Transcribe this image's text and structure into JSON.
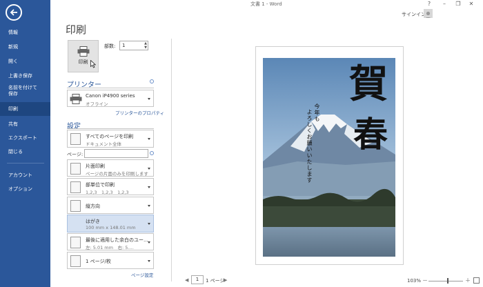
{
  "window": {
    "title": "文書 1 - Word",
    "help": "?",
    "minimize": "–",
    "restore": "❐",
    "close": "✕",
    "signin": "サインイン"
  },
  "sidebar": {
    "items": [
      {
        "label": "情報"
      },
      {
        "label": "新規"
      },
      {
        "label": "開く"
      },
      {
        "label": "上書き保存"
      },
      {
        "label": "名前を付けて"
      },
      {
        "label": "保存"
      },
      {
        "label": "印刷"
      },
      {
        "label": "共有"
      },
      {
        "label": "エクスポート"
      },
      {
        "label": "閉じる"
      },
      {
        "label": "アカウント"
      },
      {
        "label": "オプション"
      }
    ],
    "active": "印刷",
    "accent": "#2b579a"
  },
  "print": {
    "page_title": "印刷",
    "button_label": "印刷",
    "copies_label": "部数:",
    "copies_value": "1"
  },
  "printer": {
    "section_title": "プリンター",
    "name": "Canon iP4900 series",
    "status": "オフライン",
    "properties_link": "プリンターのプロパティ"
  },
  "settings": {
    "section_title": "設定",
    "range_main": "すべてのページを印刷",
    "range_sub": "ドキュメント全体",
    "pages_label": "ページ:",
    "pages_value": "",
    "sides_main": "片面印刷",
    "sides_sub": "ページの片面のみを印刷します",
    "collate_main": "部単位で印刷",
    "collate_sub": "1,2,3　1,2,3　1,2,3",
    "orientation": "縦方向",
    "paper_main": "はがき",
    "paper_sub": "100 mm x 148.01 mm",
    "margins_main": "最後に適用した余白のユー…",
    "margins_sub": "左: 5.01 mm　右: 5.…",
    "per_sheet": "1 ページ/枚",
    "page_setup_link": "ページ設定"
  },
  "preview": {
    "kanji_1": "賀",
    "kanji_2": "春",
    "line_1": "今年も",
    "line_2": "よろしくお願いいたします"
  },
  "footer": {
    "prev_arrow": "◀",
    "page_value": "1",
    "page_total": "1 ページ",
    "next_arrow": "▶",
    "zoom": "103%",
    "zoom_minus": "－",
    "zoom_plus": "＋"
  }
}
